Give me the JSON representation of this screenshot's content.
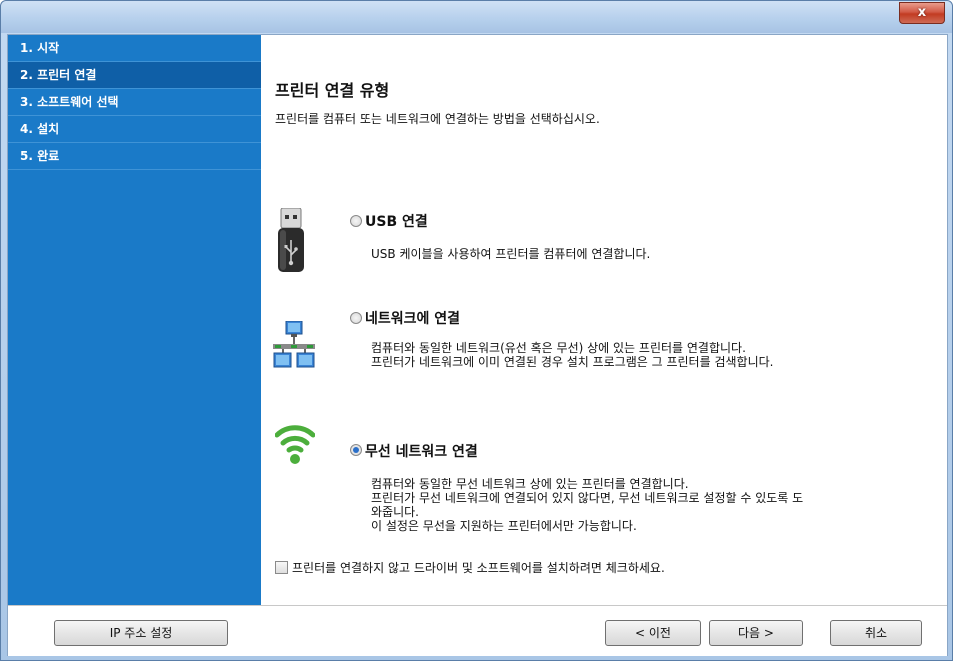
{
  "window": {
    "close_label": "x"
  },
  "sidebar": {
    "items": [
      {
        "label": "1. 시작"
      },
      {
        "label": "2. 프린터 연결"
      },
      {
        "label": "3. 소프트웨어 선택"
      },
      {
        "label": "4. 설치"
      },
      {
        "label": "5. 완료"
      }
    ]
  },
  "main": {
    "title": "프린터 연결 유형",
    "description": "프린터를 컴퓨터 또는 네트워크에 연결하는 방법을 선택하십시오.",
    "options": [
      {
        "title": "USB 연결",
        "icon": "usb-drive-icon",
        "selected": false,
        "desc_lines": [
          "USB 케이블을 사용하여 프린터를 컴퓨터에 연결합니다."
        ]
      },
      {
        "title": "네트워크에 연결",
        "icon": "network-icon",
        "selected": false,
        "desc_lines": [
          "컴퓨터와 동일한 네트워크(유선 혹은 무선) 상에 있는 프린터를 연결합니다.",
          "프린터가 네트워크에 이미 연결된 경우 설치 프로그램은 그 프린터를 검색합니다."
        ]
      },
      {
        "title": "무선 네트워크 연결",
        "icon": "wifi-icon",
        "selected": true,
        "desc_lines": [
          "컴퓨터와 동일한 무선 네트워크 상에 있는 프린터를 연결합니다.",
          "프린터가 무선 네트워크에 연결되어 있지 않다면, 무선 네트워크로 설정할 수 있도록 도",
          "와줍니다.",
          "이 설정은 무선을 지원하는 프린터에서만 가능합니다."
        ]
      }
    ],
    "checkbox_label": "프린터를 연결하지 않고 드라이버 및 소프트웨어를 설치하려면 체크하세요.",
    "checkbox_checked": false
  },
  "footer": {
    "ip_button": "IP 주소 설정",
    "back_button": "< 이전",
    "next_button": "다음 >",
    "cancel_button": "취소"
  },
  "colors": {
    "sidebar": "#1a7ac8",
    "sidebar_active": "#0f5fa7",
    "wifi_green": "#4cae3c"
  }
}
